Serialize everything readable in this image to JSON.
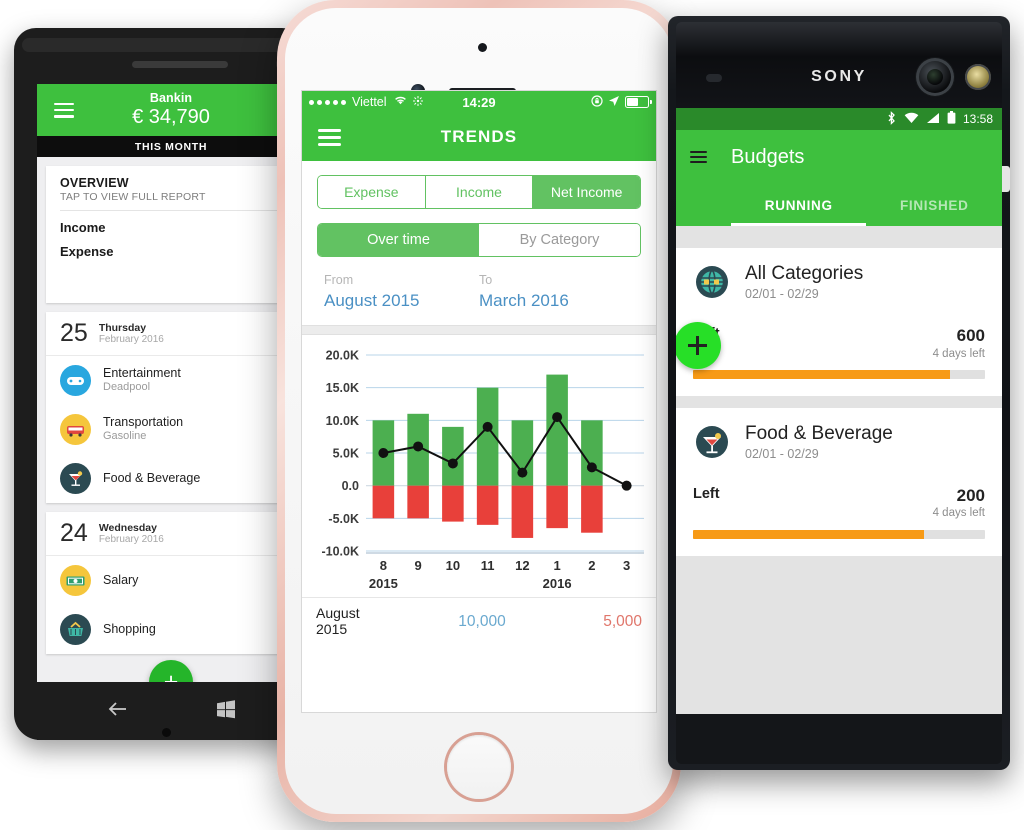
{
  "winphone": {
    "header": {
      "app_name": "Bankin",
      "balance": "€ 34,790",
      "menu_icon": "hamburger-icon"
    },
    "period_label": "THIS MONTH",
    "overview": {
      "title": "OVERVIEW",
      "subtitle": "TAP TO VIEW FULL REPORT",
      "income_label": "Income",
      "expense_label": "Expense"
    },
    "groups": [
      {
        "day": "25",
        "weekday": "Thursday",
        "month": "February 2016",
        "transactions": [
          {
            "category": "Entertainment",
            "note": "Deadpool",
            "icon": "gamepad-icon",
            "color": "#29a7df"
          },
          {
            "category": "Transportation",
            "note": "Gasoline",
            "icon": "car-icon",
            "color": "#f5c63c"
          },
          {
            "category": "Food & Beverage",
            "note": "",
            "icon": "cocktail-icon",
            "color": "#2b4a52"
          }
        ]
      },
      {
        "day": "24",
        "weekday": "Wednesday",
        "month": "February 2016",
        "transactions": [
          {
            "category": "Salary",
            "note": "",
            "icon": "banknote-icon",
            "color": "#f5c63c"
          },
          {
            "category": "Shopping",
            "note": "",
            "icon": "basket-icon",
            "color": "#2b4a52"
          }
        ]
      }
    ],
    "add_button_label": "+",
    "nav": {
      "back_icon": "back-arrow-icon",
      "home_icon": "windows-logo-icon"
    }
  },
  "iphone": {
    "status": {
      "carrier": "Viettel",
      "time": "14:29",
      "wifi_icon": "wifi-icon",
      "bluetooth_icon": "sun-icon",
      "lock_icon": "rotation-lock-icon",
      "location_icon": "location-arrow-icon",
      "battery_icon": "battery-icon",
      "battery_level": 48
    },
    "nav": {
      "title": "TRENDS",
      "menu_icon": "hamburger-icon"
    },
    "segment_type": {
      "options": [
        "Expense",
        "Income",
        "Net Income"
      ],
      "selected": "Net Income"
    },
    "segment_view": {
      "options": [
        "Over time",
        "By Category"
      ],
      "selected": "Over time"
    },
    "range": {
      "from_label": "From",
      "from_value": "August 2015",
      "to_label": "To",
      "to_value": "March 2016"
    },
    "footer": {
      "month": "August",
      "year": "2015",
      "income": "10,000",
      "expense": "5,000"
    }
  },
  "chart_data": {
    "type": "bar",
    "title": "",
    "xlabel": "",
    "ylabel": "",
    "ylim": [
      -10000,
      20000
    ],
    "ytick_labels": [
      "20.0K",
      "15.0K",
      "10.0K",
      "5.0K",
      "0.0",
      "-5.0K",
      "-10.0K"
    ],
    "ytick_values": [
      20000,
      15000,
      10000,
      5000,
      0,
      -5000,
      -10000
    ],
    "categories": [
      "8",
      "9",
      "10",
      "11",
      "12",
      "1",
      "2",
      "3"
    ],
    "year_labels": [
      {
        "label": "2015",
        "at": "8"
      },
      {
        "label": "2016",
        "at": "1"
      }
    ],
    "grid": true,
    "legend": "none",
    "series": [
      {
        "name": "Income",
        "color": "#4CAF50",
        "values": [
          10000,
          11000,
          9000,
          15000,
          10000,
          17000,
          10000,
          0
        ]
      },
      {
        "name": "Expense",
        "color": "#E8403A",
        "values": [
          -5000,
          -5000,
          -5500,
          -6000,
          -8000,
          -6500,
          -7200,
          0
        ]
      },
      {
        "name": "Net Income",
        "type": "line",
        "color": "#111111",
        "values": [
          5000,
          6000,
          3400,
          9000,
          2000,
          10500,
          2800,
          0
        ]
      }
    ]
  },
  "sony": {
    "device_logo": "SONY",
    "status": {
      "time": "13:58",
      "bluetooth_icon": "bluetooth-icon",
      "wifi_icon": "wifi-icon",
      "signal_icon": "signal-icon",
      "battery_icon": "battery-icon"
    },
    "title": "Budgets",
    "menu_icon": "hamburger-icon",
    "tabs": [
      {
        "label": "RUNNING",
        "selected": true
      },
      {
        "label": "FINISHED",
        "selected": false
      }
    ],
    "fab_icon": "plus-icon",
    "budgets": [
      {
        "name": "All Categories",
        "date_range": "02/01 - 02/29",
        "left_label": "Left",
        "amount": "600",
        "days_left": "4 days left",
        "progress": 88,
        "icon": "globe-icon",
        "icon_color": "#2b4a52",
        "bar_color": "#f79a16"
      },
      {
        "name": "Food & Beverage",
        "date_range": "02/01 - 02/29",
        "left_label": "Left",
        "amount": "200",
        "days_left": "4 days left",
        "progress": 79,
        "icon": "cocktail-icon",
        "icon_color": "#2b4a52",
        "bar_color": "#f79a16"
      }
    ],
    "nav": {
      "back_icon": "triangle-back-icon",
      "home_icon": "circle-home-icon",
      "recents_icon": "square-recents-icon"
    }
  }
}
